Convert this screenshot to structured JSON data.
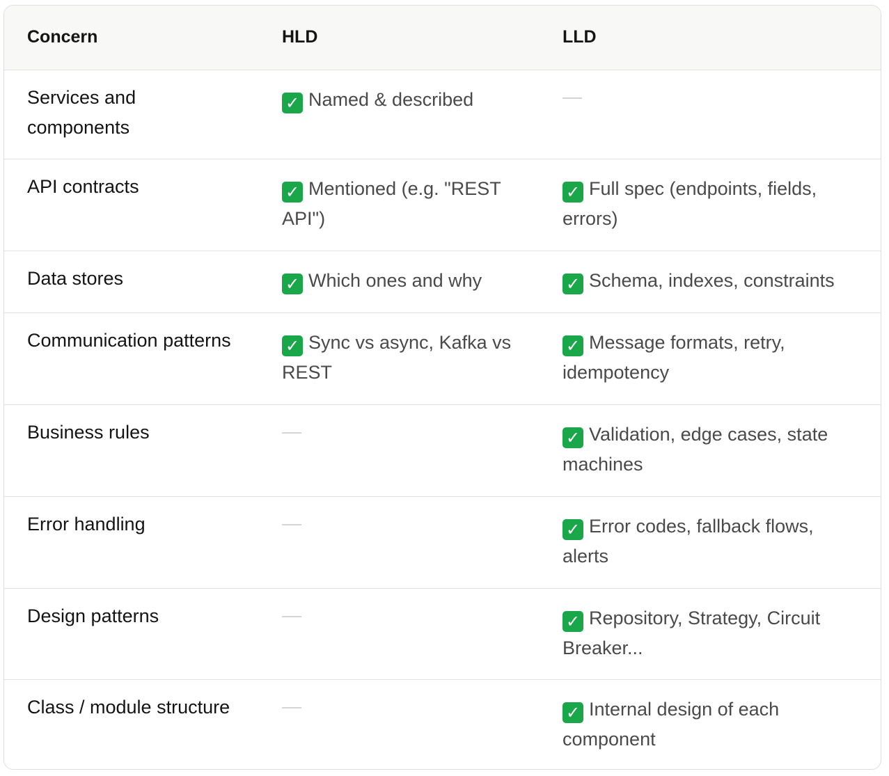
{
  "header": {
    "concern": "Concern",
    "hld": "HLD",
    "lld": "LLD"
  },
  "rows": [
    {
      "concern": "Services and components",
      "hld": "Named & described",
      "lld": "—",
      "hld_check": true,
      "lld_check": false
    },
    {
      "concern": "API contracts",
      "hld": "Mentioned (e.g. \"REST API\")",
      "lld": "Full spec (endpoints, fields, errors)",
      "hld_check": true,
      "lld_check": true
    },
    {
      "concern": "Data stores",
      "hld": "Which ones and why",
      "lld": "Schema, indexes, constraints",
      "hld_check": true,
      "lld_check": true
    },
    {
      "concern": "Communication patterns",
      "hld": "Sync vs async, Kafka vs REST",
      "lld": "Message formats, retry, idempotency",
      "hld_check": true,
      "lld_check": true
    },
    {
      "concern": "Business rules",
      "hld": "—",
      "lld": "Validation, edge cases, state machines",
      "hld_check": false,
      "lld_check": true
    },
    {
      "concern": "Error handling",
      "hld": "—",
      "lld": "Error codes, fallback flows, alerts",
      "hld_check": false,
      "lld_check": true
    },
    {
      "concern": "Design patterns",
      "hld": "—",
      "lld": "Repository, Strategy, Circuit Breaker...",
      "hld_check": false,
      "lld_check": true
    },
    {
      "concern": "Class / module structure",
      "hld": "—",
      "lld": "Internal design of each component",
      "hld_check": false,
      "lld_check": true
    }
  ],
  "icons": {
    "check": "✓",
    "check_color": "#1aa74a",
    "dash_color": "#d4d4d4"
  }
}
